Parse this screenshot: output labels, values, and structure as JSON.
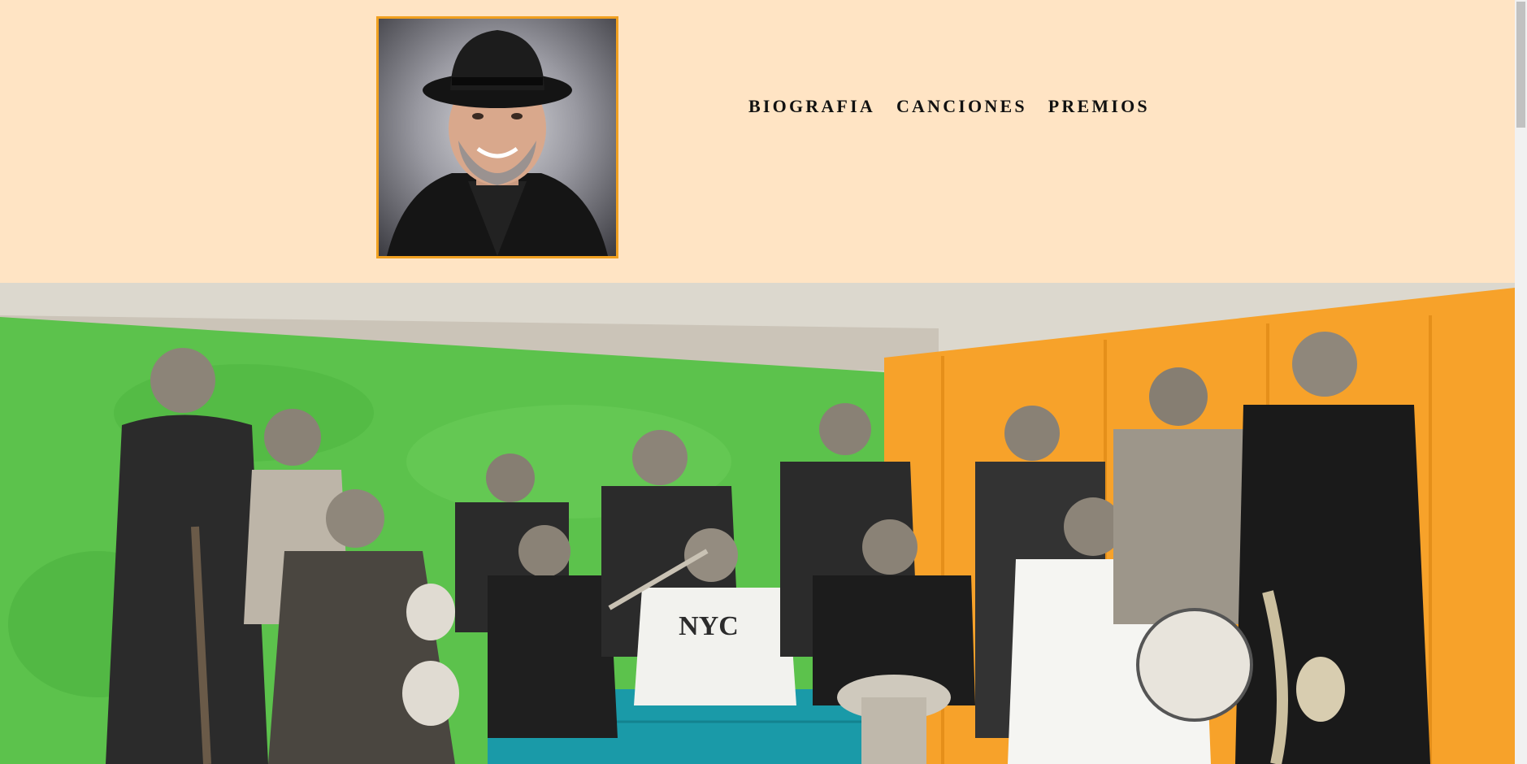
{
  "header": {
    "portrait_alt": "Rubén Blades portrait",
    "portrait_icon": "portrait-photo",
    "frame_color": "#f0a020",
    "background": "#ffe4c4"
  },
  "nav": {
    "items": [
      {
        "label": "BIOGRAFIA"
      },
      {
        "label": "CANCIONES"
      },
      {
        "label": "PREMIOS"
      }
    ]
  },
  "hero": {
    "image_alt": "Band photo",
    "colors": {
      "green_wall": "#5cc24c",
      "orange_wall": "#f7a22a",
      "teal_crate": "#1a9aa8"
    },
    "shirt_text": "NYC"
  }
}
